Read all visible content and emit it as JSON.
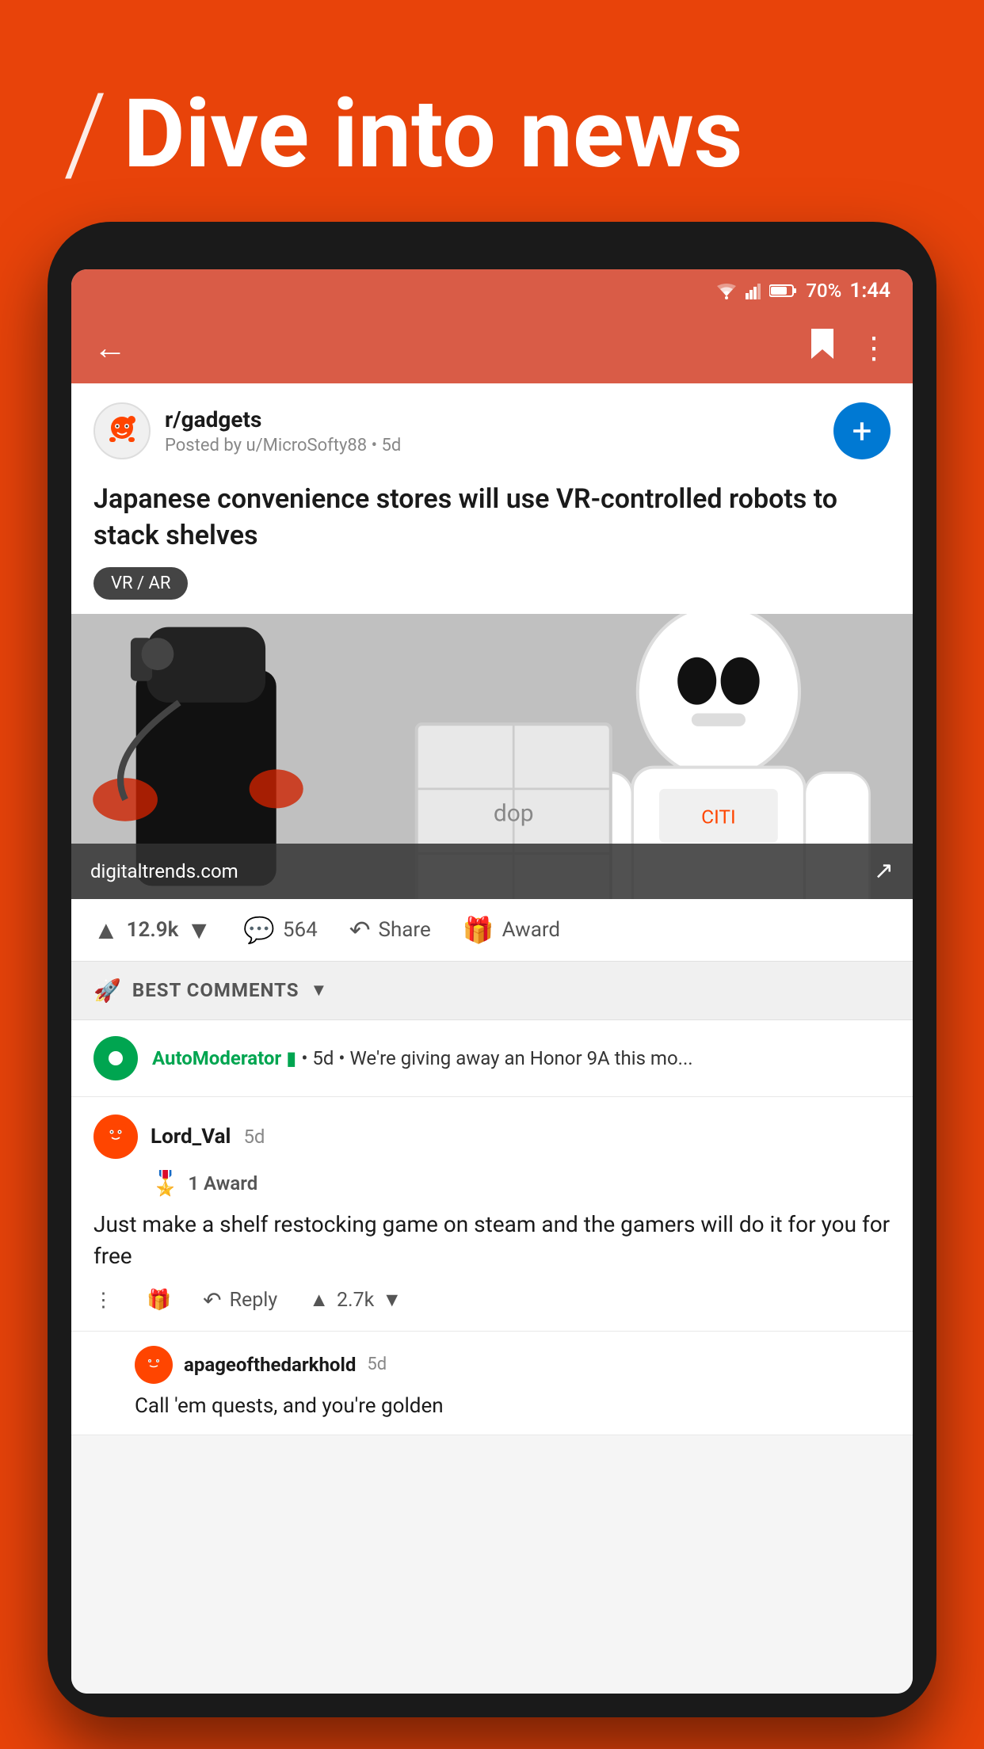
{
  "app": {
    "header_text": "Dive into news",
    "slash": "/",
    "status_bar": {
      "battery": "70%",
      "time": "1:44"
    }
  },
  "post": {
    "subreddit": "r/gadgets",
    "posted_by": "Posted by u/MicroSofty88",
    "time_ago": "5d",
    "title": "Japanese convenience stores will use VR-controlled robots to stack shelves",
    "tag": "VR / AR",
    "image_source": "digitaltrends.com",
    "votes": "12.9k",
    "comments": "564",
    "share_label": "Share",
    "award_label": "Award"
  },
  "comments": {
    "sort_label": "BEST COMMENTS",
    "automod": {
      "name": "AutoModerator",
      "time": "5d",
      "preview": "We're giving away an Honor 9A this mo..."
    },
    "comment1": {
      "username": "Lord_Val",
      "time": "5d",
      "award": "1 Award",
      "text": "Just make a shelf restocking game on steam and the gamers will do it for you for free",
      "votes": "2.7k",
      "reply_label": "Reply"
    },
    "reply1": {
      "username": "apageofthedarkhold",
      "time": "5d",
      "text": "Call 'em quests, and you're golden"
    }
  }
}
